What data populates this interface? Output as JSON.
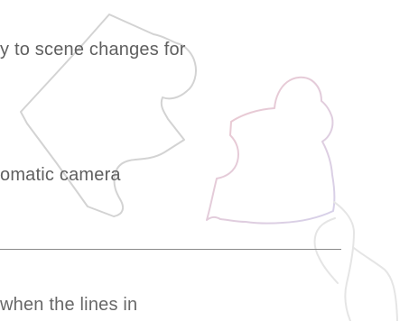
{
  "content": {
    "line_1": "y to scene changes for",
    "line_2": "omatic camera",
    "line_3": "when the lines in"
  },
  "colors": {
    "text": "#5f5f5f",
    "divider": "#8a8a8a",
    "puzzle_piece_gray": "#d3d3d3",
    "puzzle_piece_pink": "#efc7cc",
    "puzzle_piece_purple": "#d6d1ea",
    "hand_outline": "#e5e5e5"
  },
  "icons": {
    "background_art": "puzzle-hand-illustration-icon"
  }
}
